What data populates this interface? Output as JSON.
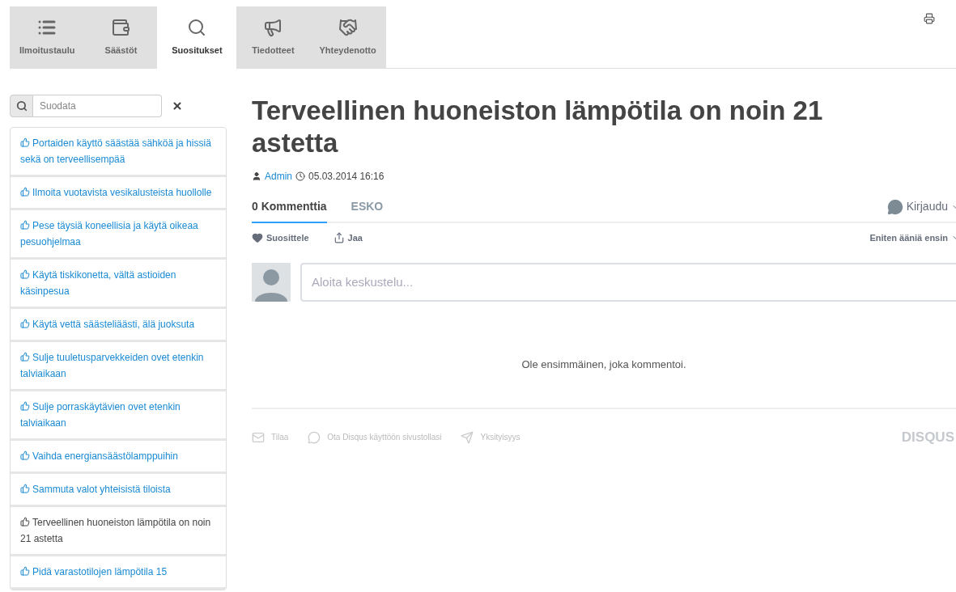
{
  "tabs": [
    {
      "label": "Ilmoitustaulu",
      "selected": false
    },
    {
      "label": "Säästöt",
      "selected": false
    },
    {
      "label": "Suositukset",
      "selected": true
    },
    {
      "label": "Tiedotteet",
      "selected": false
    },
    {
      "label": "Yhteydenotto",
      "selected": false
    }
  ],
  "filter": {
    "placeholder": "Suodata"
  },
  "recommendations": [
    {
      "title": "Portaiden käyttö säästää sähköä ja hissiä sekä on terveellisempää",
      "selected": false
    },
    {
      "title": "Ilmoita vuotavista vesikalusteista huollolle",
      "selected": false
    },
    {
      "title": "Pese täysiä koneellisia ja käytä oikeaa pesuohjelmaa",
      "selected": false
    },
    {
      "title": "Käytä tiskikonetta, vältä astioiden käsinpesua",
      "selected": false
    },
    {
      "title": "Käytä vettä säästeliäästi, älä juoksuta",
      "selected": false
    },
    {
      "title": "Sulje tuuletusparvekkeiden ovet etenkin talviaikaan",
      "selected": false
    },
    {
      "title": "Sulje porraskäytävien ovet etenkin talviaikaan",
      "selected": false
    },
    {
      "title": "Vaihda energiansäästölamppuihin",
      "selected": false
    },
    {
      "title": "Sammuta valot yhteisistä tiloista",
      "selected": false
    },
    {
      "title": "Terveellinen huoneiston lämpötila on noin 21 astetta",
      "selected": true
    },
    {
      "title": "Pidä varastotilojen lämpötila 15",
      "selected": false
    }
  ],
  "article": {
    "title": "Terveellinen huoneiston lämpötila on noin 21 astetta",
    "author": "Admin",
    "date": "05.03.2014 16:16"
  },
  "comments": {
    "tabs": [
      {
        "label": "0 Kommenttia",
        "selected": true
      },
      {
        "label": "ESKO",
        "selected": false
      }
    ],
    "login": "Kirjaudu",
    "recommend": "Suosittele",
    "share": "Jaa",
    "sort": "Eniten ääniä ensin",
    "input": {
      "placeholder": "Aloita keskustelu..."
    },
    "empty": "Ole ensimmäinen, joka kommentoi.",
    "footer": [
      "Tilaa",
      "Ota Disqus käyttöön sivustollasi",
      "Yksityisyys"
    ],
    "brand": "DISQUS"
  }
}
